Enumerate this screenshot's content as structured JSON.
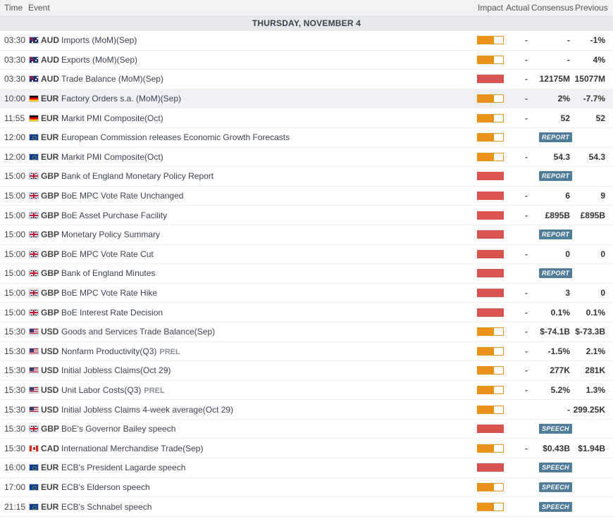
{
  "header": {
    "time": "Time",
    "event": "Event",
    "impact": "Impact",
    "actual": "Actual",
    "consensus": "Consensus",
    "previous": "Previous"
  },
  "day_label": "THURSDAY, NOVEMBER 4",
  "colors": {
    "medium_impact": "#e8921a",
    "high_impact": "#d9534f",
    "badge": "#4f7c98"
  },
  "rows": [
    {
      "time": "03:30",
      "flag": "aud",
      "currency": "AUD",
      "event": "Imports (MoM)(Sep)",
      "tag": "",
      "impact": "medium",
      "actual": "-",
      "consensus": "-",
      "previous": "-1%",
      "badge": ""
    },
    {
      "time": "03:30",
      "flag": "aud",
      "currency": "AUD",
      "event": "Exports (MoM)(Sep)",
      "tag": "",
      "impact": "medium",
      "actual": "-",
      "consensus": "-",
      "previous": "4%",
      "badge": ""
    },
    {
      "time": "03:30",
      "flag": "aud",
      "currency": "AUD",
      "event": "Trade Balance (MoM)(Sep)",
      "tag": "",
      "impact": "high",
      "actual": "-",
      "consensus": "12175M",
      "previous": "15077M",
      "badge": ""
    },
    {
      "time": "10:00",
      "flag": "de",
      "currency": "EUR",
      "event": "Factory Orders s.a. (MoM)(Sep)",
      "tag": "",
      "impact": "medium",
      "actual": "-",
      "consensus": "2%",
      "previous": "-7.7%",
      "badge": "",
      "highlight": true
    },
    {
      "time": "11:55",
      "flag": "de",
      "currency": "EUR",
      "event": "Markit PMI Composite(Oct)",
      "tag": "",
      "impact": "medium",
      "actual": "-",
      "consensus": "52",
      "previous": "52",
      "badge": ""
    },
    {
      "time": "12:00",
      "flag": "eur",
      "currency": "EUR",
      "event": "European Commission releases Economic Growth Forecasts",
      "tag": "",
      "impact": "medium",
      "actual": "",
      "consensus": "",
      "previous": "",
      "badge": "REPORT"
    },
    {
      "time": "12:00",
      "flag": "eur",
      "currency": "EUR",
      "event": "Markit PMI Composite(Oct)",
      "tag": "",
      "impact": "medium",
      "actual": "-",
      "consensus": "54.3",
      "previous": "54.3",
      "badge": ""
    },
    {
      "time": "15:00",
      "flag": "gb",
      "currency": "GBP",
      "event": "Bank of England Monetary Policy Report",
      "tag": "",
      "impact": "high",
      "actual": "",
      "consensus": "",
      "previous": "",
      "badge": "REPORT"
    },
    {
      "time": "15:00",
      "flag": "gb",
      "currency": "GBP",
      "event": "BoE MPC Vote Rate Unchanged",
      "tag": "",
      "impact": "high",
      "actual": "-",
      "consensus": "6",
      "previous": "9",
      "badge": ""
    },
    {
      "time": "15:00",
      "flag": "gb",
      "currency": "GBP",
      "event": "BoE Asset Purchase Facility",
      "tag": "",
      "impact": "high",
      "actual": "-",
      "consensus": "£895B",
      "previous": "£895B",
      "badge": ""
    },
    {
      "time": "15:00",
      "flag": "gb",
      "currency": "GBP",
      "event": "Monetary Policy Summary",
      "tag": "",
      "impact": "high",
      "actual": "",
      "consensus": "",
      "previous": "",
      "badge": "REPORT"
    },
    {
      "time": "15:00",
      "flag": "gb",
      "currency": "GBP",
      "event": "BoE MPC Vote Rate Cut",
      "tag": "",
      "impact": "high",
      "actual": "-",
      "consensus": "0",
      "previous": "0",
      "badge": ""
    },
    {
      "time": "15:00",
      "flag": "gb",
      "currency": "GBP",
      "event": "Bank of England Minutes",
      "tag": "",
      "impact": "high",
      "actual": "",
      "consensus": "",
      "previous": "",
      "badge": "REPORT"
    },
    {
      "time": "15:00",
      "flag": "gb",
      "currency": "GBP",
      "event": "BoE MPC Vote Rate Hike",
      "tag": "",
      "impact": "high",
      "actual": "-",
      "consensus": "3",
      "previous": "0",
      "badge": ""
    },
    {
      "time": "15:00",
      "flag": "gb",
      "currency": "GBP",
      "event": "BoE Interest Rate Decision",
      "tag": "",
      "impact": "high",
      "actual": "-",
      "consensus": "0.1%",
      "previous": "0.1%",
      "badge": ""
    },
    {
      "time": "15:30",
      "flag": "us",
      "currency": "USD",
      "event": "Goods and Services Trade Balance(Sep)",
      "tag": "",
      "impact": "medium",
      "actual": "-",
      "consensus": "$-74.1B",
      "previous": "$-73.3B",
      "badge": ""
    },
    {
      "time": "15:30",
      "flag": "us",
      "currency": "USD",
      "event": "Nonfarm Productivity(Q3)",
      "tag": "PREL",
      "impact": "medium",
      "actual": "-",
      "consensus": "-1.5%",
      "previous": "2.1%",
      "badge": ""
    },
    {
      "time": "15:30",
      "flag": "us",
      "currency": "USD",
      "event": "Initial Jobless Claims(Oct 29)",
      "tag": "",
      "impact": "medium",
      "actual": "-",
      "consensus": "277K",
      "previous": "281K",
      "badge": ""
    },
    {
      "time": "15:30",
      "flag": "us",
      "currency": "USD",
      "event": "Unit Labor Costs(Q3)",
      "tag": "PREL",
      "impact": "medium",
      "actual": "-",
      "consensus": "5.2%",
      "previous": "1.3%",
      "badge": ""
    },
    {
      "time": "15:30",
      "flag": "us",
      "currency": "USD",
      "event": "Initial Jobless Claims 4-week average(Oct 29)",
      "tag": "",
      "impact": "medium",
      "actual": "",
      "consensus": "-",
      "previous": "299.25K",
      "badge": ""
    },
    {
      "time": "15:30",
      "flag": "gb",
      "currency": "GBP",
      "event": "BoE's Governor Bailey speech",
      "tag": "",
      "impact": "high",
      "actual": "",
      "consensus": "",
      "previous": "",
      "badge": "SPEECH"
    },
    {
      "time": "15:30",
      "flag": "ca",
      "currency": "CAD",
      "event": "International Merchandise Trade(Sep)",
      "tag": "",
      "impact": "medium",
      "actual": "-",
      "consensus": "$0.43B",
      "previous": "$1.94B",
      "badge": ""
    },
    {
      "time": "16:00",
      "flag": "eur",
      "currency": "EUR",
      "event": "ECB's President Lagarde speech",
      "tag": "",
      "impact": "high",
      "actual": "",
      "consensus": "",
      "previous": "",
      "badge": "SPEECH"
    },
    {
      "time": "17:00",
      "flag": "eur",
      "currency": "EUR",
      "event": "ECB's Elderson speech",
      "tag": "",
      "impact": "medium",
      "actual": "",
      "consensus": "",
      "previous": "",
      "badge": "SPEECH"
    },
    {
      "time": "21:15",
      "flag": "eur",
      "currency": "EUR",
      "event": "ECB's Schnabel speech",
      "tag": "",
      "impact": "medium",
      "actual": "",
      "consensus": "",
      "previous": "",
      "badge": "SPEECH"
    }
  ]
}
